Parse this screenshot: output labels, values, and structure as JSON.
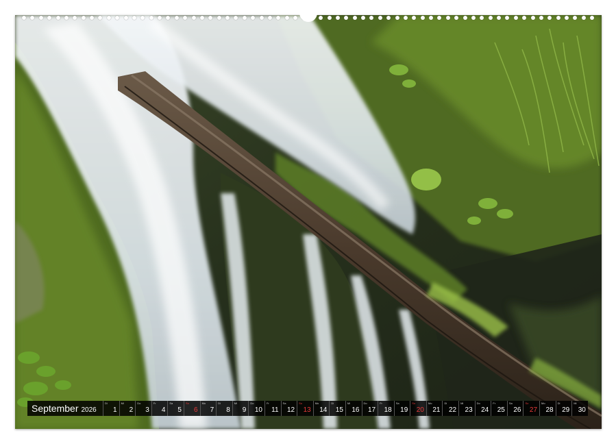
{
  "calendar": {
    "month": "September",
    "year": "2026",
    "days": [
      {
        "n": "1",
        "d": "Di",
        "sun": false
      },
      {
        "n": "2",
        "d": "Mi",
        "sun": false
      },
      {
        "n": "3",
        "d": "Do",
        "sun": false
      },
      {
        "n": "4",
        "d": "Fr",
        "sun": false
      },
      {
        "n": "5",
        "d": "Sa",
        "sun": false
      },
      {
        "n": "6",
        "d": "So",
        "sun": true
      },
      {
        "n": "7",
        "d": "Mo",
        "sun": false
      },
      {
        "n": "8",
        "d": "Di",
        "sun": false
      },
      {
        "n": "9",
        "d": "Mi",
        "sun": false
      },
      {
        "n": "10",
        "d": "Do",
        "sun": false
      },
      {
        "n": "11",
        "d": "Fr",
        "sun": false
      },
      {
        "n": "12",
        "d": "Sa",
        "sun": false
      },
      {
        "n": "13",
        "d": "So",
        "sun": true
      },
      {
        "n": "14",
        "d": "Mo",
        "sun": false
      },
      {
        "n": "15",
        "d": "Di",
        "sun": false
      },
      {
        "n": "16",
        "d": "Mi",
        "sun": false
      },
      {
        "n": "17",
        "d": "Do",
        "sun": false
      },
      {
        "n": "18",
        "d": "Fr",
        "sun": false
      },
      {
        "n": "19",
        "d": "Sa",
        "sun": false
      },
      {
        "n": "20",
        "d": "So",
        "sun": true
      },
      {
        "n": "21",
        "d": "Mo",
        "sun": false
      },
      {
        "n": "22",
        "d": "Di",
        "sun": false
      },
      {
        "n": "23",
        "d": "Mi",
        "sun": false
      },
      {
        "n": "24",
        "d": "Do",
        "sun": false
      },
      {
        "n": "25",
        "d": "Fr",
        "sun": false
      },
      {
        "n": "26",
        "d": "Sa",
        "sun": false
      },
      {
        "n": "27",
        "d": "So",
        "sun": true
      },
      {
        "n": "28",
        "d": "Mo",
        "sun": false
      },
      {
        "n": "29",
        "d": "Di",
        "sun": false
      },
      {
        "n": "30",
        "d": "Mi",
        "sun": false
      }
    ]
  },
  "colors": {
    "sunday": "#e83a3a",
    "strip_background": "#000000",
    "moss": "#5d7a23",
    "water": "#eef3f6",
    "log": "#4a3a2c"
  },
  "photo": {
    "subject": "waterfall-over-mossy-log"
  }
}
